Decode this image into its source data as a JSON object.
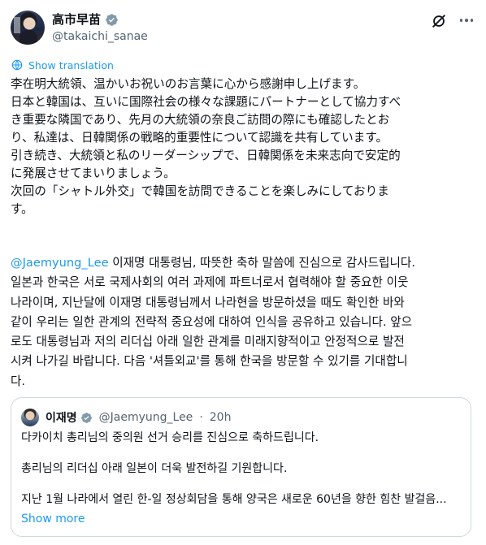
{
  "author": {
    "name": "高市早苗",
    "handle": "@takaichi_sanae"
  },
  "icons": {
    "verified": "verified-badge-icon",
    "grok": "grok-icon",
    "more": "more-options-icon",
    "translate": "globe-icon"
  },
  "colors": {
    "link": "#1d9bf0",
    "muted": "#536471",
    "border": "#cfd9de"
  },
  "translate_label": "Show translation",
  "japanese_lines": [
    "李在明大統領、温かいお祝いのお言葉に心から感謝申し上げます。",
    "日本と韓国は、互いに国際社会の様々な課題にパートナーとして協力すべ",
    "き重要な隣国であり、先月の大統領の奈良ご訪問の際にも確認したとお",
    "り、私達は、日韓関係の戦略的重要性について認識を共有しています。",
    "引き続き、大統領と私のリーダーシップで、日韓関係を未来志向で安定的",
    "に発展させてまいりましょう。",
    "次回の「シャトル外交」で韓国を訪問できることを楽しみにしておりま",
    "す。"
  ],
  "korean": {
    "mention": "@Jaemyung_Lee",
    "first_line_rest": " 이재명 대통령님, 따뜻한 축하 말씀에 진심으로 감사드립니다.",
    "lines": [
      "일본과 한국은 서로 국제사회의 여러 과제에 파트너로서 협력해야 할 중요한 이웃",
      "나라이며, 지난달에 이재명 대통령님께서 나라현을 방문하셨을 때도 확인한 바와",
      "같이 우리는 일한 관계의 전략적 중요성에 대하여 인식을 공유하고 있습니다. 앞으",
      "로도 대통령님과 저의 리더십 아래 일한 관계를 미래지향적이고 안정적으로 발전",
      "시켜 나가길 바랍니다. 다음 '셔틀외교'를 통해 한국을 방문할 수 있기를 기대합니",
      "다."
    ]
  },
  "quoted_tweet": {
    "name": "이재명",
    "handle": "@Jaemyung_Lee",
    "separator": "·",
    "time": "20h",
    "line1": "다카이치 총리님의 중의원 선거 승리를 진심으로 축하드립니다.",
    "line2": "총리님의 리더십 아래 일본이 더욱 발전하길 기원합니다.",
    "line3": "지난 1월 나라에서 열린 한-일 정상회담을 통해 양국은 새로운 60년을 향한 힘찬 발걸음...",
    "show_more": "Show more"
  }
}
